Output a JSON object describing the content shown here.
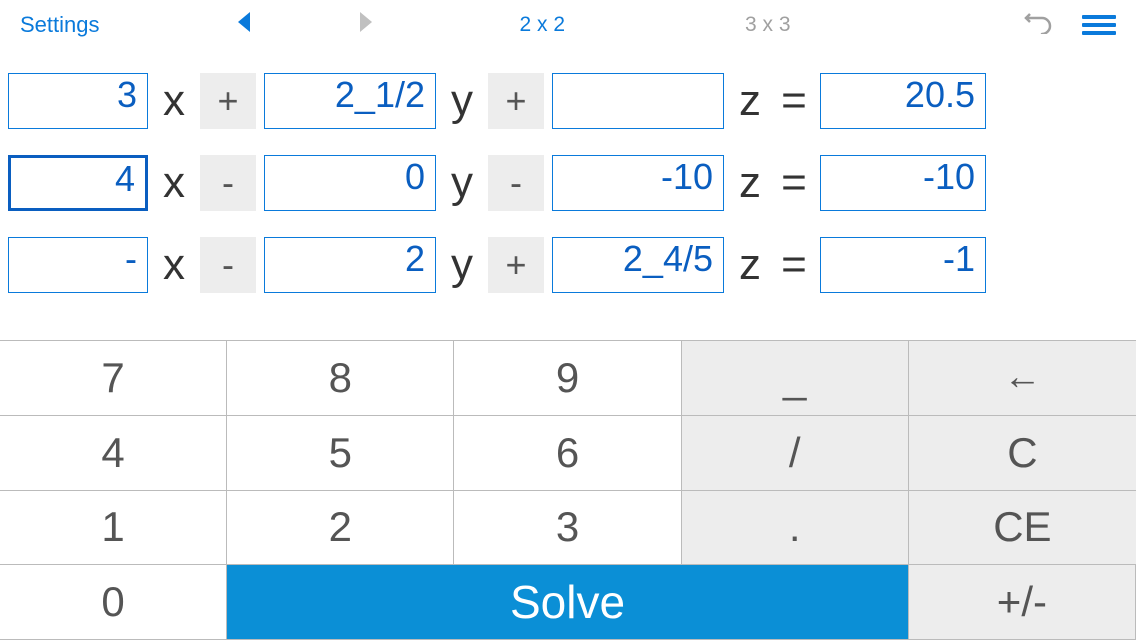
{
  "header": {
    "settings": "Settings",
    "tab_active": "2 x 2",
    "tab_inactive": "3 x 3"
  },
  "equations": [
    {
      "x_coef": "3",
      "op1": "+",
      "y_coef": "2_1/2",
      "op2": "+",
      "z_coef": "",
      "result": "20.5",
      "x_focused": false
    },
    {
      "x_coef": "4",
      "op1": "-",
      "y_coef": "0",
      "op2": "-",
      "z_coef": "-10",
      "result": "-10",
      "x_focused": true
    },
    {
      "x_coef": "-",
      "op1": "-",
      "y_coef": "2",
      "op2": "+",
      "z_coef": "2_4/5",
      "result": "-1",
      "x_focused": false
    }
  ],
  "vars": {
    "x": "x",
    "y": "y",
    "z": "z",
    "eq": "="
  },
  "keypad": {
    "k7": "7",
    "k8": "8",
    "k9": "9",
    "underscore": "_",
    "back": "←",
    "k4": "4",
    "k5": "5",
    "k6": "6",
    "slash": "/",
    "c": "C",
    "k1": "1",
    "k2": "2",
    "k3": "3",
    "dot": ".",
    "ce": "CE",
    "k0": "0",
    "solve": "Solve",
    "plusminus": "+/-"
  }
}
